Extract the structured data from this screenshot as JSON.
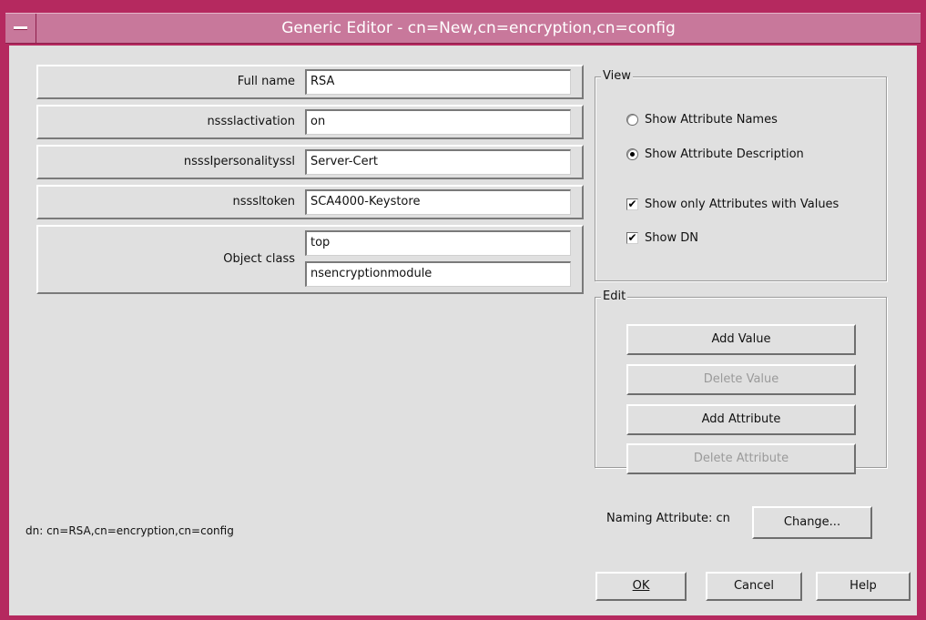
{
  "window": {
    "title": "Generic Editor - cn=New,cn=encryption,cn=config"
  },
  "attributes": {
    "full_name": {
      "label": "Full name",
      "value": "RSA"
    },
    "activation": {
      "label": "nssslactivation",
      "value": "on"
    },
    "personality": {
      "label": "nsssIpersonalityssl",
      "value": "Server-Cert"
    },
    "token": {
      "label": "nsssltoken",
      "value": "SCA4000-Keystore"
    },
    "object_class": {
      "label": "Object class",
      "values": [
        "top",
        "nsencryptionmodule"
      ]
    }
  },
  "view": {
    "legend": "View",
    "show_names": {
      "label": "Show Attribute Names",
      "selected": false
    },
    "show_description": {
      "label": "Show Attribute Description",
      "selected": true
    },
    "only_with_values": {
      "label": "Show only Attributes with Values",
      "checked": true
    },
    "show_dn": {
      "label": "Show DN",
      "checked": true
    }
  },
  "edit": {
    "legend": "Edit",
    "add_value": {
      "label": "Add Value",
      "enabled": true
    },
    "delete_value": {
      "label": "Delete Value",
      "enabled": false
    },
    "add_attribute": {
      "label": "Add Attribute",
      "enabled": true
    },
    "delete_attribute": {
      "label": "Delete Attribute",
      "enabled": false
    }
  },
  "naming": {
    "label": "Naming Attribute: cn",
    "change_label": "Change..."
  },
  "dn_text": "dn: cn=RSA,cn=encryption,cn=config",
  "footer": {
    "ok": "OK",
    "cancel": "Cancel",
    "help": "Help"
  }
}
